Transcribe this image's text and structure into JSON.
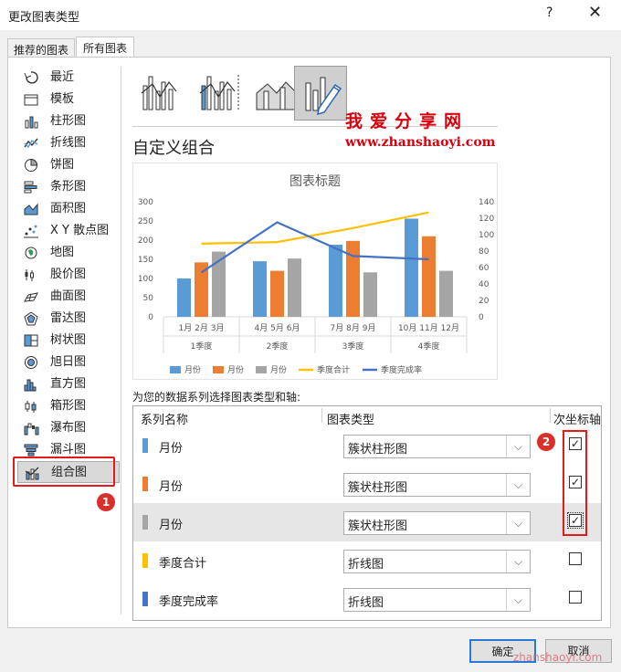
{
  "window": {
    "title": "更改图表类型",
    "help": "?",
    "close": "✕"
  },
  "tabs": [
    {
      "label": "推荐的图表"
    },
    {
      "label": "所有图表"
    }
  ],
  "sidebar": {
    "items": [
      {
        "label": "最近",
        "icon": "recent-icon"
      },
      {
        "label": "模板",
        "icon": "template-icon"
      },
      {
        "label": "柱形图",
        "icon": "column-chart-icon"
      },
      {
        "label": "折线图",
        "icon": "line-chart-icon"
      },
      {
        "label": "饼图",
        "icon": "pie-chart-icon"
      },
      {
        "label": "条形图",
        "icon": "bar-chart-icon"
      },
      {
        "label": "面积图",
        "icon": "area-chart-icon"
      },
      {
        "label": "X Y 散点图",
        "icon": "scatter-chart-icon"
      },
      {
        "label": "地图",
        "icon": "map-chart-icon"
      },
      {
        "label": "股价图",
        "icon": "stock-chart-icon"
      },
      {
        "label": "曲面图",
        "icon": "surface-chart-icon"
      },
      {
        "label": "雷达图",
        "icon": "radar-chart-icon"
      },
      {
        "label": "树状图",
        "icon": "treemap-chart-icon"
      },
      {
        "label": "旭日图",
        "icon": "sunburst-chart-icon"
      },
      {
        "label": "直方图",
        "icon": "histogram-chart-icon"
      },
      {
        "label": "箱形图",
        "icon": "box-chart-icon"
      },
      {
        "label": "瀑布图",
        "icon": "waterfall-chart-icon"
      },
      {
        "label": "漏斗图",
        "icon": "funnel-chart-icon"
      },
      {
        "label": "组合图",
        "icon": "combo-chart-icon"
      }
    ],
    "active_index": 18
  },
  "badges": {
    "one": "1",
    "two": "2"
  },
  "watermark": {
    "text": "我爱分享网",
    "url": "www.zhanshaoyi.com",
    "footer": "zhanshaoyi.com"
  },
  "section_title": "自定义组合",
  "chart_data": {
    "type": "bar",
    "title": "图表标题",
    "categories": [
      "1月",
      "2月",
      "3月",
      "4月",
      "5月",
      "6月",
      "7月",
      "8月",
      "9月",
      "10月",
      "11月",
      "12月"
    ],
    "groups": [
      "1季度",
      "2季度",
      "3季度",
      "4季度"
    ],
    "group_month_labels": [
      "1月 2月 3月",
      "4月 5月 6月",
      "7月 8月 9月",
      "10月 11月 12月"
    ],
    "y_left": {
      "ticks": [
        "300",
        "250",
        "200",
        "150",
        "100",
        "50",
        "0"
      ],
      "ylim": [
        0,
        300
      ]
    },
    "y_right": {
      "ticks": [
        "140",
        "120",
        "100",
        "80",
        "60",
        "40",
        "20",
        "0"
      ],
      "ylim": [
        0,
        140
      ]
    },
    "bar_values": [
      [
        100,
        142,
        170
      ],
      [
        145,
        120,
        152
      ],
      [
        188,
        198,
        116
      ],
      [
        256,
        210,
        120
      ]
    ],
    "bar_colors": [
      "#5b9bd5",
      "#ed7d31",
      "#a5a5a5"
    ],
    "series": [
      {
        "name": "月份",
        "color": "#5b9bd5"
      },
      {
        "name": "月份",
        "color": "#ed7d31"
      },
      {
        "name": "月份",
        "color": "#a5a5a5"
      },
      {
        "name": "季度合计",
        "color": "#ffc000",
        "values": [
          89,
          91,
          108,
          127
        ]
      },
      {
        "name": "季度完成率",
        "color": "#4472c4",
        "values": [
          54,
          115,
          74,
          70
        ]
      }
    ]
  },
  "series_prompt": "为您的数据系列选择图表类型和轴:",
  "grid": {
    "headers": {
      "name": "系列名称",
      "type": "图表类型",
      "secondary": "次坐标轴"
    },
    "rows": [
      {
        "name": "月份",
        "color": "#5b9bd5",
        "type": "簇状柱形图",
        "secondary": true
      },
      {
        "name": "月份",
        "color": "#ed7d31",
        "type": "簇状柱形图",
        "secondary": true
      },
      {
        "name": "月份",
        "color": "#a5a5a5",
        "type": "簇状柱形图",
        "secondary": true
      },
      {
        "name": "季度合计",
        "color": "#ffc000",
        "type": "折线图",
        "secondary": false
      },
      {
        "name": "季度完成率",
        "color": "#4472c4",
        "type": "折线图",
        "secondary": false
      }
    ],
    "highlight_index": 2
  },
  "buttons": {
    "ok": "确定",
    "cancel": "取消"
  },
  "check_mark": "✓",
  "dropdown_glyph": "⌵"
}
